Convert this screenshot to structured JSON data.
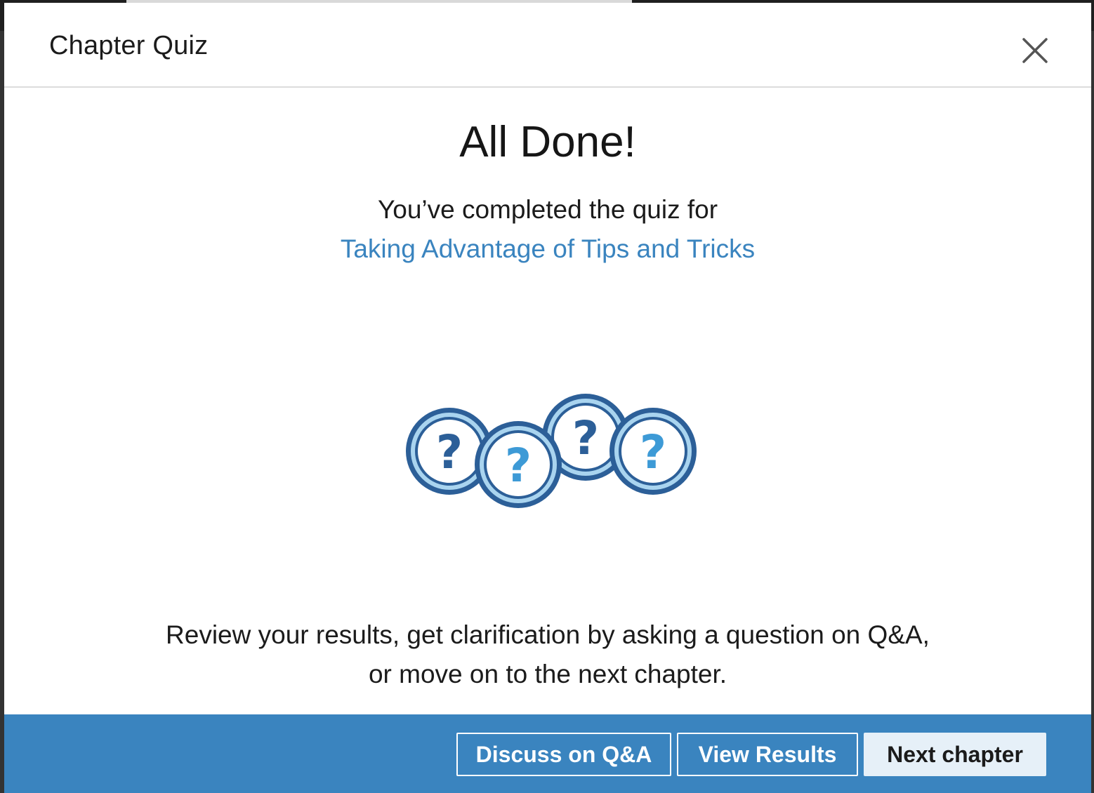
{
  "modal": {
    "title": "Chapter Quiz",
    "close_icon": "close-icon"
  },
  "content": {
    "headline": "All Done!",
    "completed_text": "You’ve completed the quiz for",
    "chapter_link": "Taking Advantage of Tips and Tricks",
    "illustration_icon": "question-coins-icon",
    "review_line1": "Review your results, get clarification by asking a question on Q&A,",
    "review_line2": "or move on to the next chapter."
  },
  "footer": {
    "discuss_label": "Discuss on Q&A",
    "results_label": "View Results",
    "next_label": "Next chapter"
  },
  "colors": {
    "accent": "#3a84bf",
    "coin_dark": "#2c5f98",
    "coin_light": "#a9d4ef",
    "qmark_dark": "#2c5f98",
    "qmark_light": "#3d9ad6"
  }
}
